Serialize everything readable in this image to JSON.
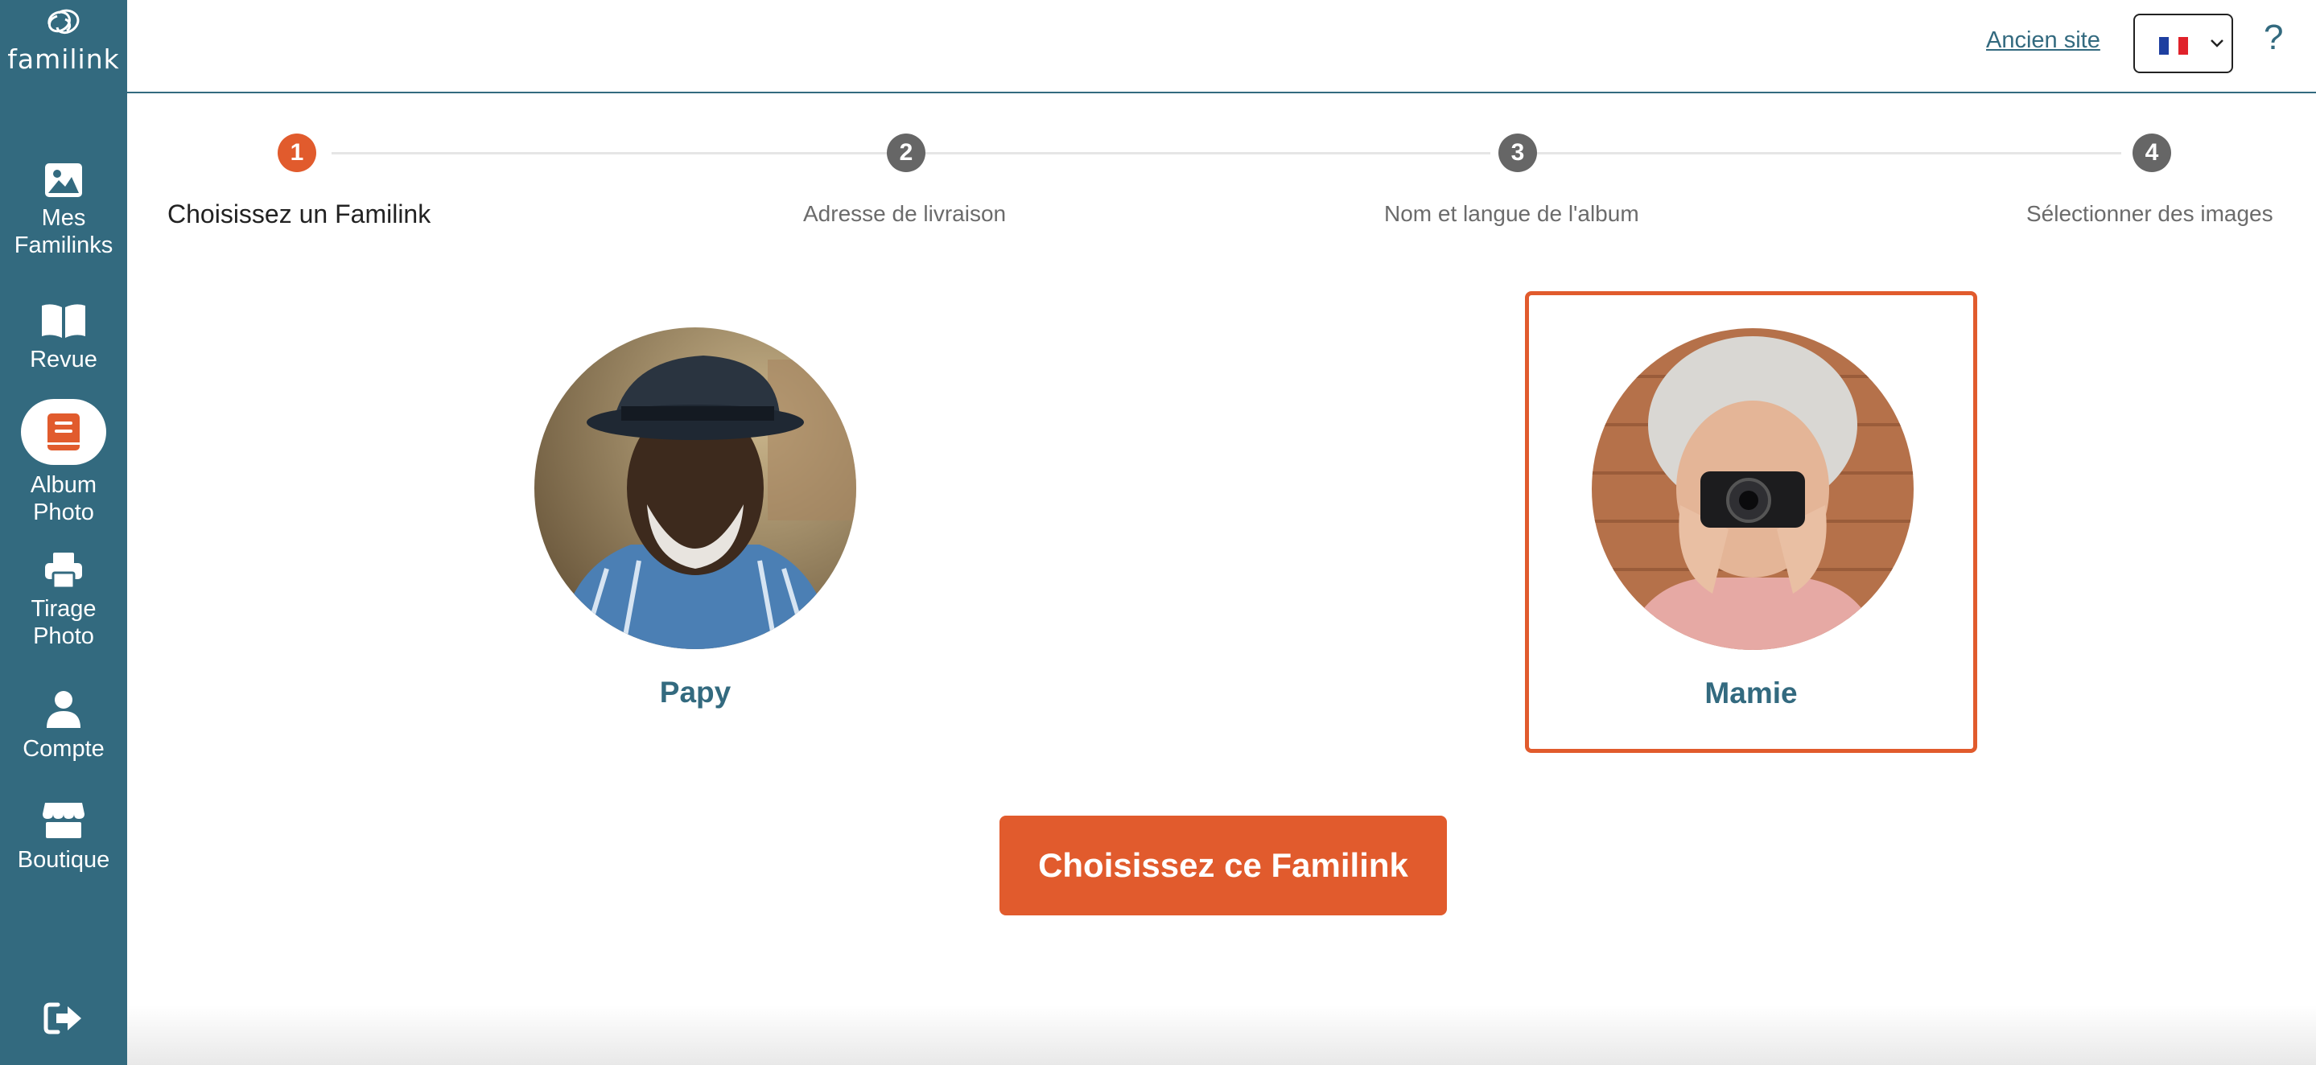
{
  "app": {
    "logo_text": "familink"
  },
  "sidebar": {
    "items": [
      {
        "label_line1": "Mes",
        "label_line2": "Familinks",
        "icon": "image-icon"
      },
      {
        "label_line1": "Revue",
        "label_line2": "",
        "icon": "book-icon"
      },
      {
        "label_line1": "Album",
        "label_line2": "Photo",
        "icon": "photo-album-icon",
        "active": true
      },
      {
        "label_line1": "Tirage",
        "label_line2": "Photo",
        "icon": "printer-icon"
      },
      {
        "label_line1": "Compte",
        "label_line2": "",
        "icon": "user-icon"
      },
      {
        "label_line1": "Boutique",
        "label_line2": "",
        "icon": "store-icon"
      }
    ],
    "logout_icon": "logout-icon"
  },
  "header": {
    "old_site_link": "Ancien site",
    "language": {
      "selected": "FR",
      "flag_icon": "france-flag-icon"
    },
    "help_label": "?"
  },
  "stepper": {
    "steps": [
      {
        "number": "1",
        "label": "Choisissez un Familink",
        "active": true
      },
      {
        "number": "2",
        "label": "Adresse de livraison",
        "active": false
      },
      {
        "number": "3",
        "label": "Nom et langue de l'album",
        "active": false
      },
      {
        "number": "4",
        "label": "Sélectionner des images",
        "active": false
      }
    ]
  },
  "familinks": [
    {
      "name": "Papy",
      "selected": false
    },
    {
      "name": "Mamie",
      "selected": true
    }
  ],
  "cta": {
    "label": "Choisissez ce Familink"
  },
  "colors": {
    "primary": "#336a7f",
    "accent": "#e15b2d",
    "step_inactive": "#6b6b6b",
    "line": "#e6e6e6"
  }
}
